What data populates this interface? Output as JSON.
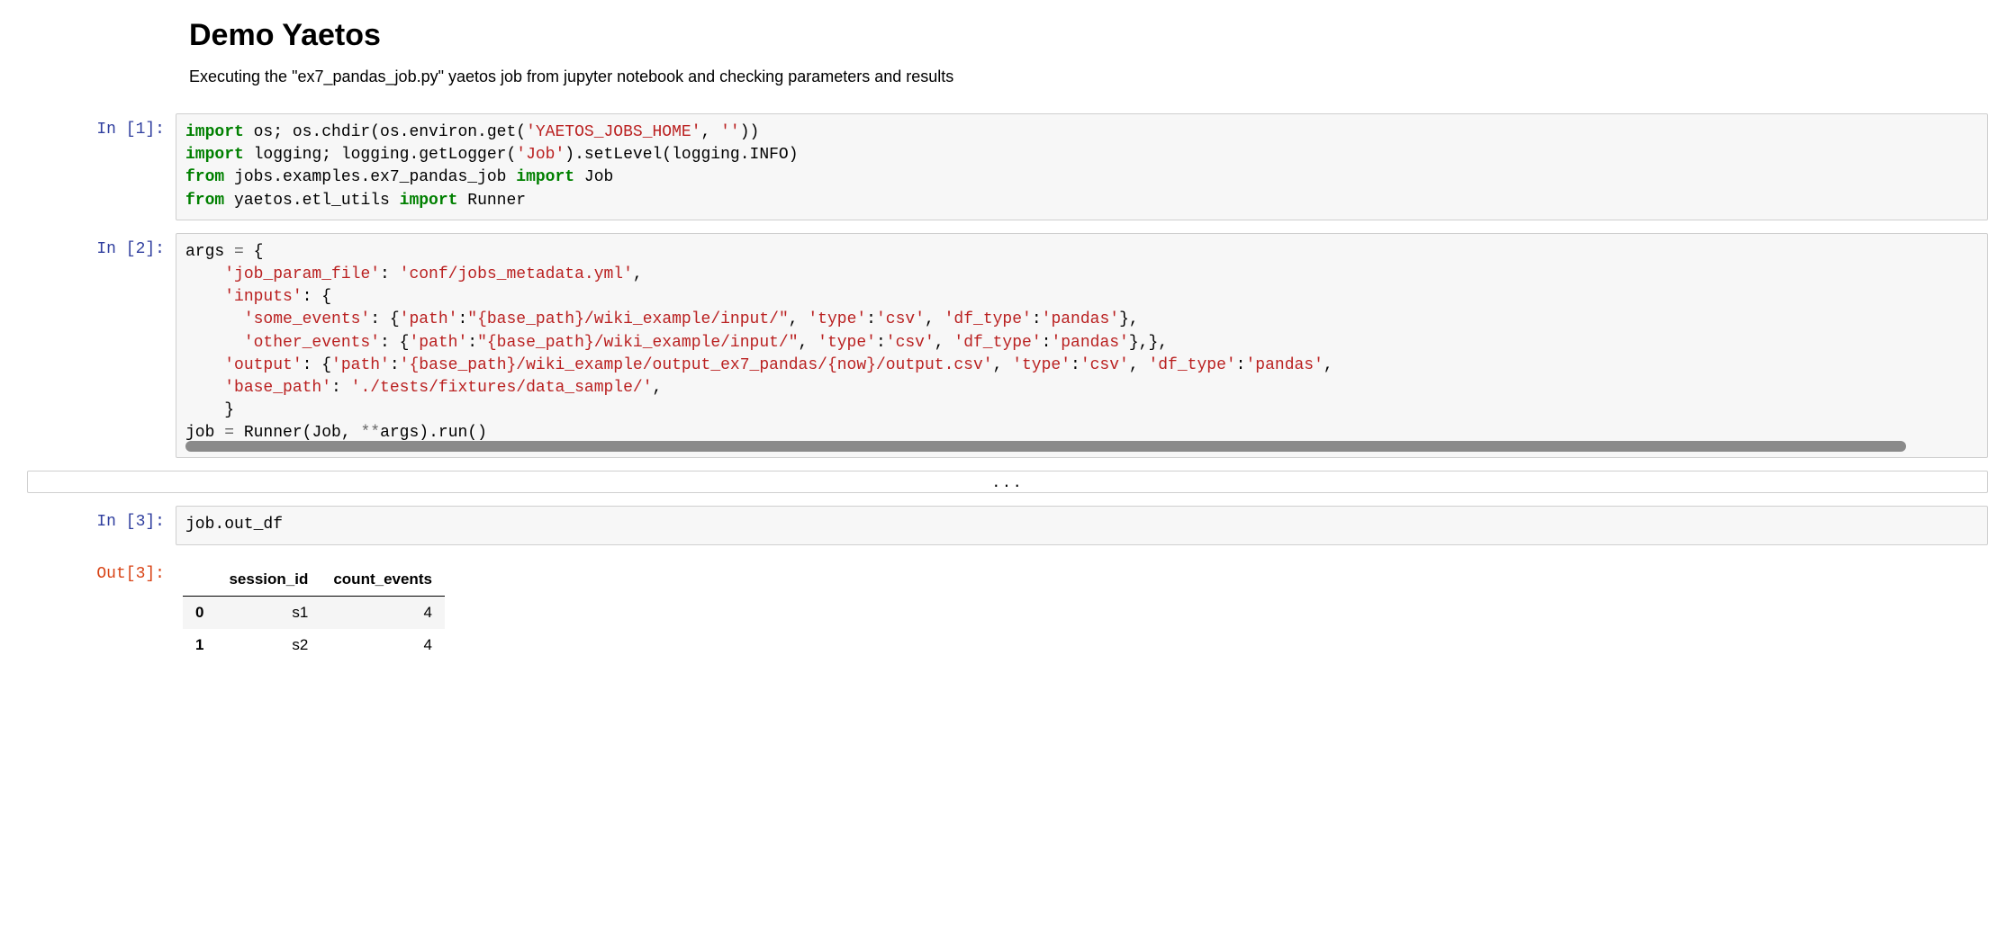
{
  "header": {
    "title": "Demo Yaetos",
    "subtitle": "Executing the \"ex7_pandas_job.py\" yaetos job from jupyter notebook and checking parameters and results"
  },
  "cells": {
    "c1": {
      "prompt": "In [1]:",
      "tokens": [
        {
          "t": "import",
          "c": "kw"
        },
        {
          "t": " os; os.chdir(os.environ.get(",
          "c": "nm"
        },
        {
          "t": "'YAETOS_JOBS_HOME'",
          "c": "str"
        },
        {
          "t": ", ",
          "c": "nm"
        },
        {
          "t": "''",
          "c": "str"
        },
        {
          "t": "))\n",
          "c": "nm"
        },
        {
          "t": "import",
          "c": "kw"
        },
        {
          "t": " logging; logging.getLogger(",
          "c": "nm"
        },
        {
          "t": "'Job'",
          "c": "str"
        },
        {
          "t": ").setLevel(logging.INFO)\n",
          "c": "nm"
        },
        {
          "t": "from",
          "c": "kw"
        },
        {
          "t": " jobs.examples.ex7_pandas_job ",
          "c": "nm"
        },
        {
          "t": "import",
          "c": "kw"
        },
        {
          "t": " Job\n",
          "c": "nm"
        },
        {
          "t": "from",
          "c": "kw"
        },
        {
          "t": " yaetos.etl_utils ",
          "c": "nm"
        },
        {
          "t": "import",
          "c": "kw"
        },
        {
          "t": " Runner",
          "c": "nm"
        }
      ]
    },
    "c2": {
      "prompt": "In [2]:",
      "tokens": [
        {
          "t": "args ",
          "c": "nm"
        },
        {
          "t": "=",
          "c": "op"
        },
        {
          "t": " {\n    ",
          "c": "nm"
        },
        {
          "t": "'job_param_file'",
          "c": "str"
        },
        {
          "t": ": ",
          "c": "nm"
        },
        {
          "t": "'conf/jobs_metadata.yml'",
          "c": "str"
        },
        {
          "t": ",\n    ",
          "c": "nm"
        },
        {
          "t": "'inputs'",
          "c": "str"
        },
        {
          "t": ": {\n      ",
          "c": "nm"
        },
        {
          "t": "'some_events'",
          "c": "str"
        },
        {
          "t": ": {",
          "c": "nm"
        },
        {
          "t": "'path'",
          "c": "str"
        },
        {
          "t": ":",
          "c": "nm"
        },
        {
          "t": "\"{base_path}/wiki_example/input/\"",
          "c": "str"
        },
        {
          "t": ", ",
          "c": "nm"
        },
        {
          "t": "'type'",
          "c": "str"
        },
        {
          "t": ":",
          "c": "nm"
        },
        {
          "t": "'csv'",
          "c": "str"
        },
        {
          "t": ", ",
          "c": "nm"
        },
        {
          "t": "'df_type'",
          "c": "str"
        },
        {
          "t": ":",
          "c": "nm"
        },
        {
          "t": "'pandas'",
          "c": "str"
        },
        {
          "t": "},\n      ",
          "c": "nm"
        },
        {
          "t": "'other_events'",
          "c": "str"
        },
        {
          "t": ": {",
          "c": "nm"
        },
        {
          "t": "'path'",
          "c": "str"
        },
        {
          "t": ":",
          "c": "nm"
        },
        {
          "t": "\"{base_path}/wiki_example/input/\"",
          "c": "str"
        },
        {
          "t": ", ",
          "c": "nm"
        },
        {
          "t": "'type'",
          "c": "str"
        },
        {
          "t": ":",
          "c": "nm"
        },
        {
          "t": "'csv'",
          "c": "str"
        },
        {
          "t": ", ",
          "c": "nm"
        },
        {
          "t": "'df_type'",
          "c": "str"
        },
        {
          "t": ":",
          "c": "nm"
        },
        {
          "t": "'pandas'",
          "c": "str"
        },
        {
          "t": "},},\n    ",
          "c": "nm"
        },
        {
          "t": "'output'",
          "c": "str"
        },
        {
          "t": ": {",
          "c": "nm"
        },
        {
          "t": "'path'",
          "c": "str"
        },
        {
          "t": ":",
          "c": "nm"
        },
        {
          "t": "'{base_path}/wiki_example/output_ex7_pandas/{now}/output.csv'",
          "c": "str"
        },
        {
          "t": ", ",
          "c": "nm"
        },
        {
          "t": "'type'",
          "c": "str"
        },
        {
          "t": ":",
          "c": "nm"
        },
        {
          "t": "'csv'",
          "c": "str"
        },
        {
          "t": ", ",
          "c": "nm"
        },
        {
          "t": "'df_type'",
          "c": "str"
        },
        {
          "t": ":",
          "c": "nm"
        },
        {
          "t": "'pandas'",
          "c": "str"
        },
        {
          "t": ",\n    ",
          "c": "nm"
        },
        {
          "t": "'base_path'",
          "c": "str"
        },
        {
          "t": ": ",
          "c": "nm"
        },
        {
          "t": "'./tests/fixtures/data_sample/'",
          "c": "str"
        },
        {
          "t": ",\n    }\n",
          "c": "nm"
        },
        {
          "t": "job ",
          "c": "nm"
        },
        {
          "t": "=",
          "c": "op"
        },
        {
          "t": " Runner(Job, ",
          "c": "nm"
        },
        {
          "t": "**",
          "c": "op"
        },
        {
          "t": "args).run()",
          "c": "nm"
        }
      ]
    },
    "collapsed": "...",
    "c3": {
      "prompt": "In [3]:",
      "tokens": [
        {
          "t": "job.out_df",
          "c": "nm"
        }
      ]
    },
    "out3": {
      "prompt": "Out[3]:",
      "table": {
        "columns": [
          "session_id",
          "count_events"
        ],
        "index": [
          "0",
          "1"
        ],
        "rows": [
          [
            "s1",
            "4"
          ],
          [
            "s2",
            "4"
          ]
        ]
      }
    }
  }
}
